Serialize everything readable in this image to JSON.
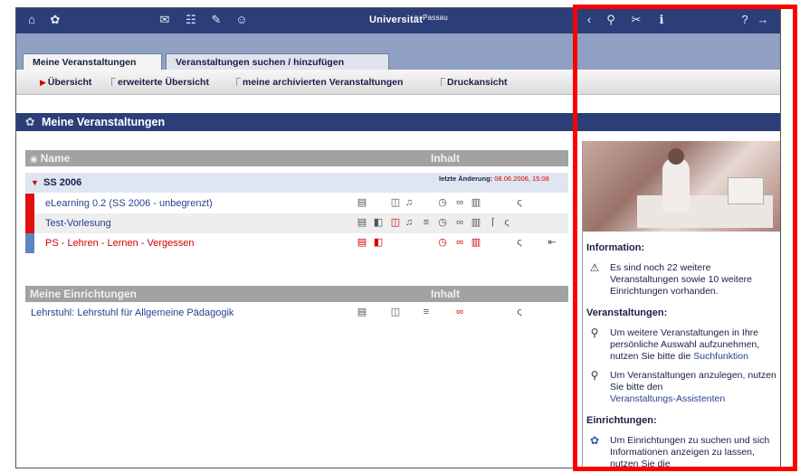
{
  "app": {
    "title_main": "Universität",
    "title_sub": "Passau"
  },
  "tabs": [
    {
      "label": "Meine Veranstaltungen",
      "active": true
    },
    {
      "label": "Veranstaltungen suchen / hinzufügen",
      "active": false
    }
  ],
  "subnav": [
    {
      "label": "Übersicht",
      "active": true
    },
    {
      "label": "erweiterte Übersicht",
      "active": false
    },
    {
      "label": "meine archivierten Veranstaltungen",
      "active": false
    },
    {
      "label": "Druckansicht",
      "active": false
    }
  ],
  "page_title": "Meine Veranstaltungen",
  "courses_table": {
    "header_name": "Name",
    "header_content": "Inhalt",
    "semester": "SS 2006",
    "last_change_label": "letzte Änderung:",
    "last_change_value": "08.06.2006, 15:08",
    "rows": [
      {
        "name": "eLearning 0.2 (SS 2006 - unbegrenzt)",
        "color": "#e01010",
        "highlight": false
      },
      {
        "name": "Test-Vorlesung",
        "color": "#e01010",
        "highlight": false
      },
      {
        "name": "PS - Lehren - Lernen - Vergessen",
        "color": "#5b86c3",
        "highlight": true
      }
    ]
  },
  "institutions_table": {
    "header_name": "Meine Einrichtungen",
    "header_content": "Inhalt",
    "rows": [
      {
        "name": "Lehrstuhl: Lehrstuhl für Allgemeine Pädagogik"
      }
    ]
  },
  "sidebar": {
    "information_head": "Information:",
    "information_text": "Es sind noch 22 weitere Veranstaltungen sowie 10 weitere Einrichtungen vorhanden.",
    "courses_head": "Veranstaltungen:",
    "courses_item1_text": "Um weitere Veranstaltungen in Ihre persönliche Auswahl aufzunehmen, nutzen Sie bitte die",
    "courses_item1_link": "Suchfunktion",
    "courses_item2_text": "Um Veranstaltungen anzulegen, nutzen Sie bitte den",
    "courses_item2_link": "Veranstaltungs-Assistenten",
    "institutions_head": "Einrichtungen:",
    "institutions_text": "Um Einrichtungen zu suchen und sich Informationen anzeigen zu lassen, nutzen Sie die"
  },
  "icons": {
    "toolbar": [
      "home-icon",
      "gear-icon",
      "mail-icon",
      "contacts-icon",
      "chat-icon",
      "user-icon",
      "search-icon",
      "tools-icon",
      "info-icon",
      "help-icon",
      "logout-icon"
    ],
    "highlight_color": "#ff0000",
    "accent": "#2c3e78"
  }
}
